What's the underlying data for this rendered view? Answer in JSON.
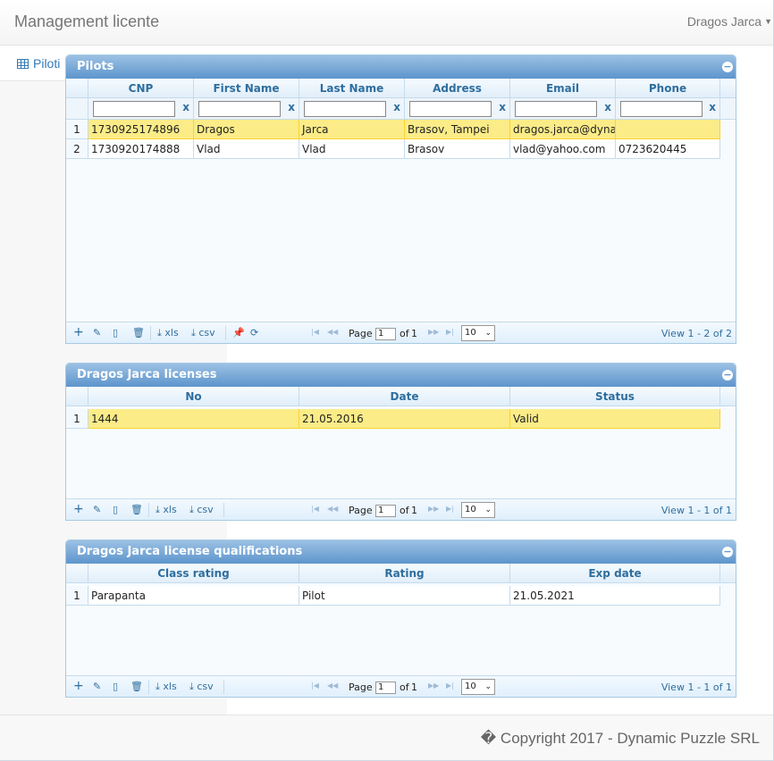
{
  "app": {
    "title": "Management licente",
    "user": "Dragos Jarca"
  },
  "sidebar": {
    "items": [
      {
        "label": "Piloti",
        "icon": "table-icon"
      }
    ]
  },
  "footer": {
    "copyright": "� Copyright 2017 - Dynamic Puzzle SRL"
  },
  "pager_labels": {
    "add": "+",
    "export_xls": "xls",
    "export_csv": "csv",
    "page": "Page",
    "of": "of"
  },
  "grids": {
    "pilots": {
      "title": "Pilots",
      "columns": [
        "CNP",
        "First Name",
        "Last Name",
        "Address",
        "Email",
        "Phone"
      ],
      "filter_clear": "x",
      "rows": [
        {
          "num": "1",
          "cells": [
            "1730925174896",
            "Dragos",
            "Jarca",
            "Brasov, Tampei",
            "dragos.jarca@dynar",
            ""
          ]
        },
        {
          "num": "2",
          "cells": [
            "1730920174888",
            "Vlad",
            "Vlad",
            "Brasov",
            "vlad@yahoo.com",
            "0723620445"
          ]
        }
      ],
      "pager": {
        "page": "1",
        "total_pages": "1",
        "rows_per_page": "10",
        "view": "View 1 - 2 of 2"
      }
    },
    "licenses": {
      "title": "Dragos Jarca licenses",
      "columns": [
        "No",
        "Date",
        "Status"
      ],
      "rows": [
        {
          "num": "1",
          "cells": [
            "1444",
            "21.05.2016",
            "Valid"
          ]
        }
      ],
      "pager": {
        "page": "1",
        "total_pages": "1",
        "rows_per_page": "10",
        "view": "View 1 - 1 of 1"
      }
    },
    "qualifications": {
      "title": "Dragos Jarca license qualifications",
      "columns": [
        "Class rating",
        "Rating",
        "Exp date"
      ],
      "rows": [
        {
          "num": "1",
          "cells": [
            "Parapanta",
            "Pilot",
            "21.05.2021"
          ]
        }
      ],
      "pager": {
        "page": "1",
        "total_pages": "1",
        "rows_per_page": "10",
        "view": "View 1 - 1 of 1"
      }
    }
  },
  "colors": {
    "selected_row": "#fbec88",
    "header_text": "#2e6e9e",
    "title_bar": "#5d95cc"
  }
}
